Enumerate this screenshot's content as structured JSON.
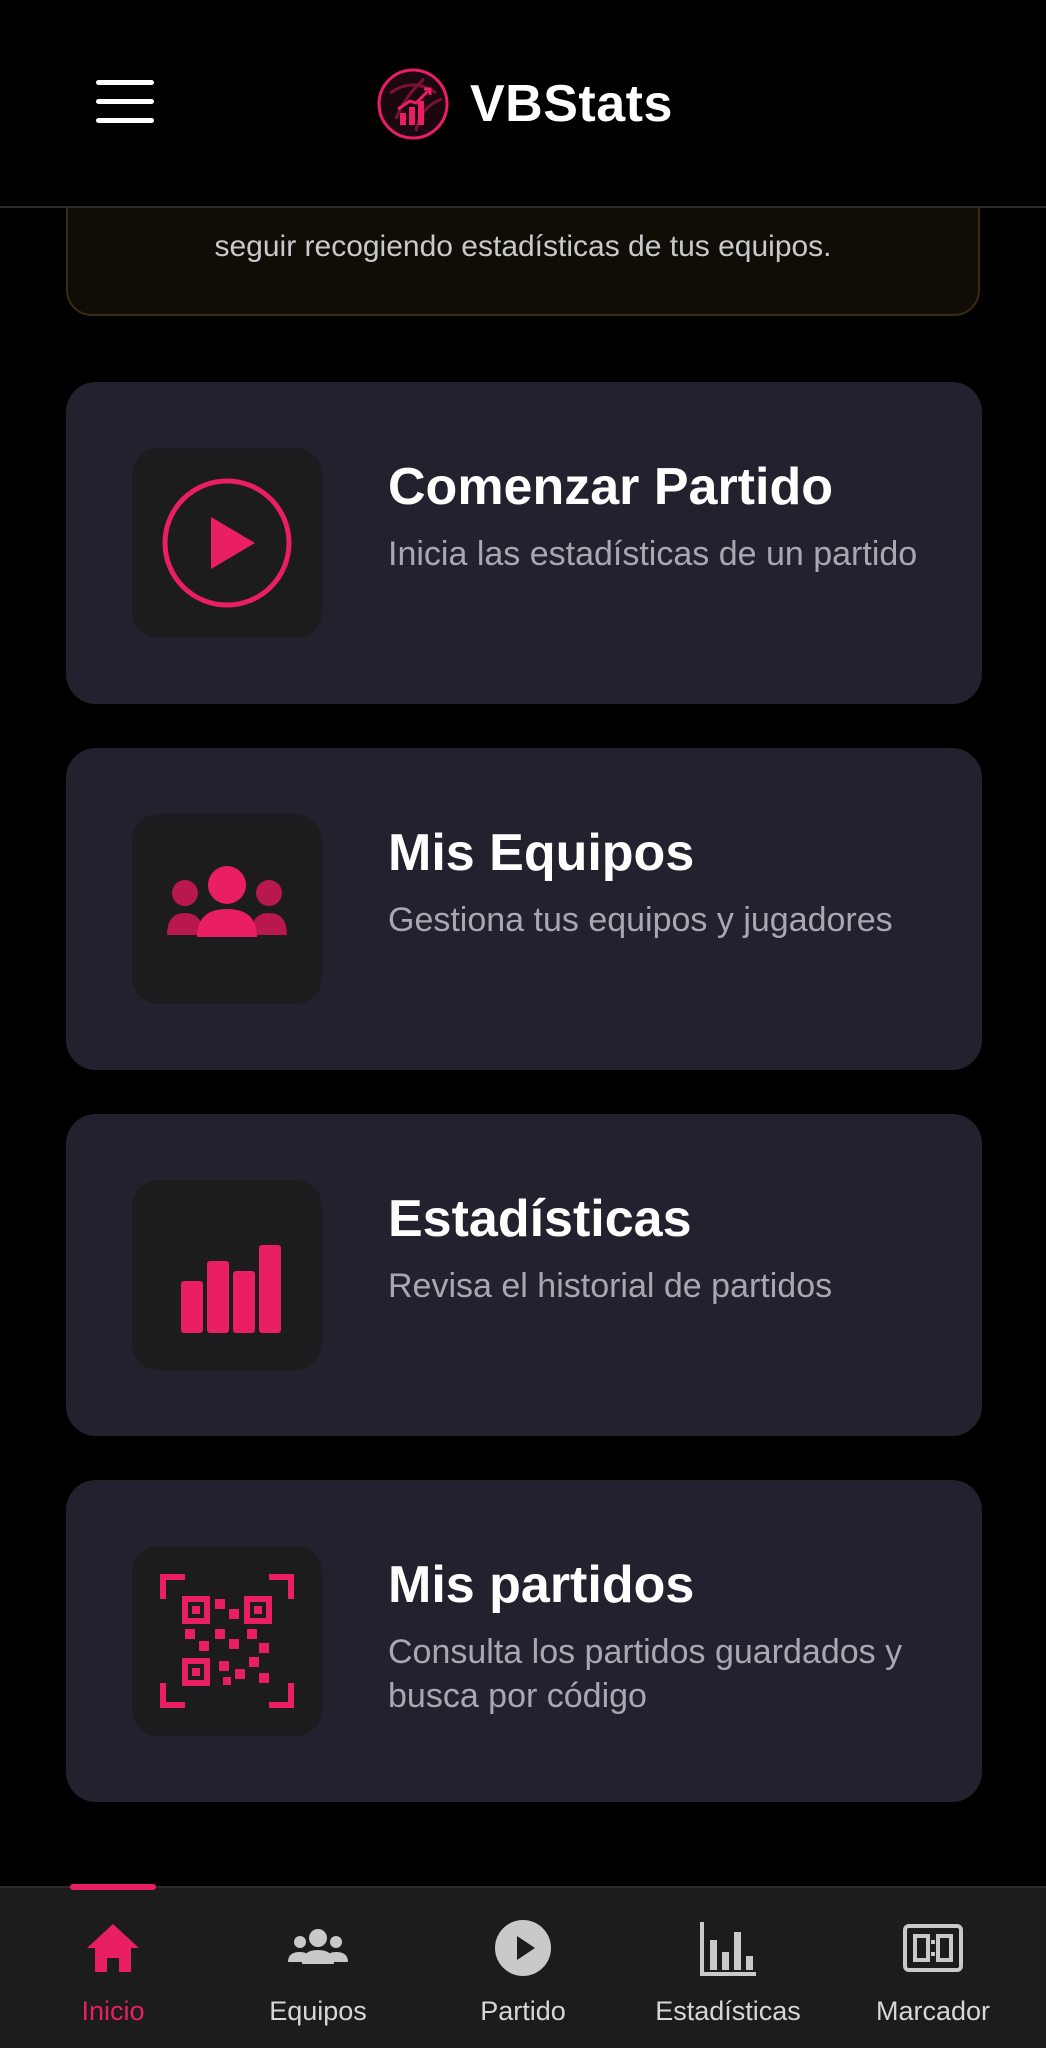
{
  "colors": {
    "accent": "#e91e63",
    "background": "#000000",
    "card": "#24212e",
    "icon_tile": "#1c1c1e",
    "muted_text": "#a9a7b1"
  },
  "header": {
    "menu_icon": "hamburger-menu-icon",
    "logo_icon": "volleyball-chart-logo",
    "app_name": "VBStats"
  },
  "notice": {
    "text": "seguir recogiendo estadísticas de tus equipos."
  },
  "cards": [
    {
      "icon": "play-circle-icon",
      "title": "Comenzar Partido",
      "subtitle": "Inicia las estadísticas de un partido"
    },
    {
      "icon": "team-group-icon",
      "title": "Mis Equipos",
      "subtitle": "Gestiona tus equipos y jugadores"
    },
    {
      "icon": "bar-chart-icon",
      "title": "Estadísticas",
      "subtitle": "Revisa el historial de partidos"
    },
    {
      "icon": "qr-scan-icon",
      "title": "Mis partidos",
      "subtitle": "Consulta los partidos guardados y busca por código"
    }
  ],
  "bottom_nav": {
    "active": "Inicio",
    "items": [
      {
        "label": "Inicio",
        "icon": "home-icon"
      },
      {
        "label": "Equipos",
        "icon": "people-icon"
      },
      {
        "label": "Partido",
        "icon": "play-circle-icon"
      },
      {
        "label": "Estadísticas",
        "icon": "bar-chart-icon"
      },
      {
        "label": "Marcador",
        "icon": "scoreboard-icon"
      }
    ]
  }
}
